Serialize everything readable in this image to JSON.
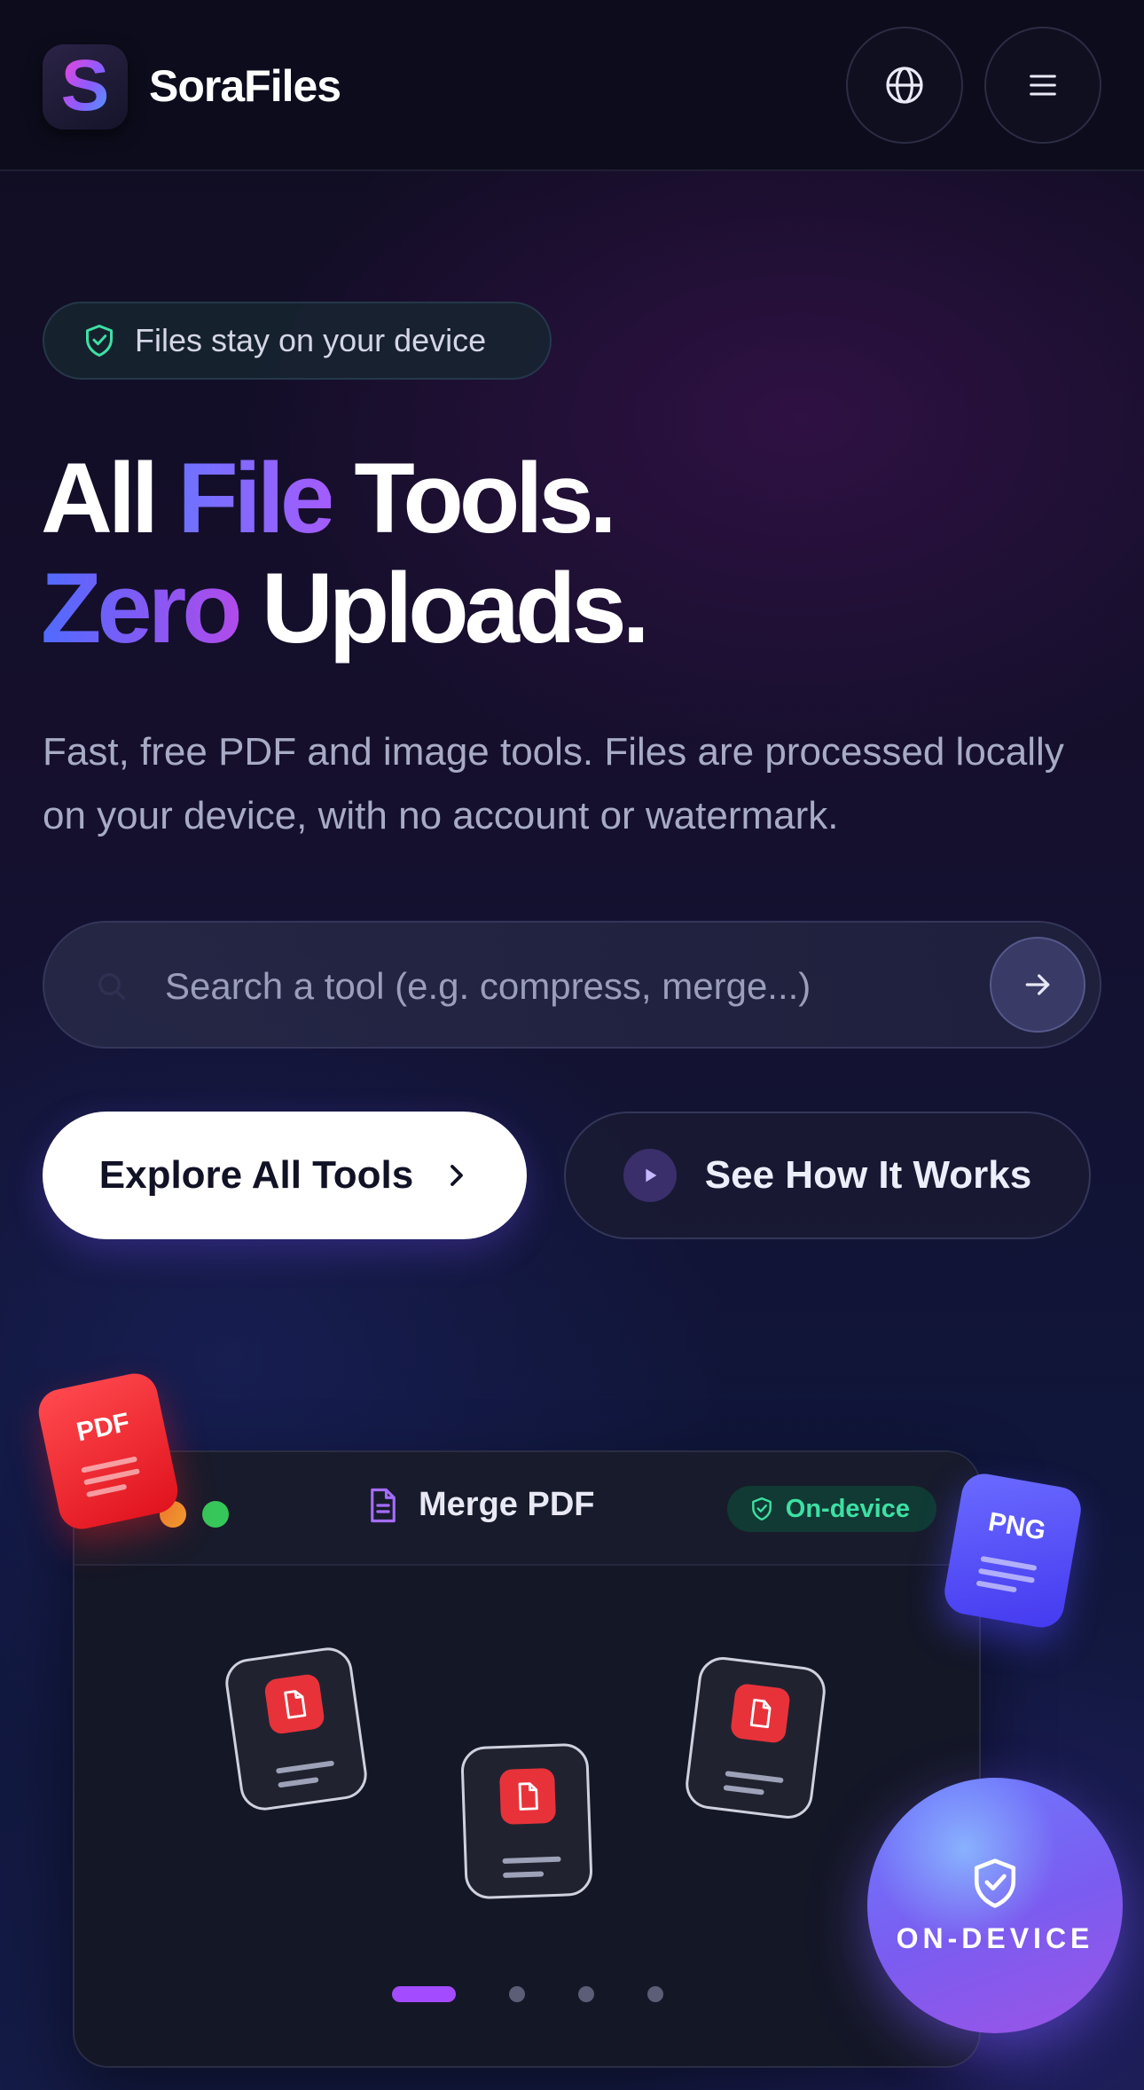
{
  "header": {
    "brand": "SoraFiles",
    "logo_letter": "S",
    "language_icon": "globe-icon",
    "menu_icon": "hamburger-menu-icon"
  },
  "hero": {
    "badge": "Files stay on your device",
    "headline_line1": {
      "w1": "All",
      "w2": "File",
      "w3": "Tools."
    },
    "headline_line2": {
      "w1": "Zero",
      "w2": "Uploads."
    },
    "subtitle": "Fast, free PDF and image tools. Files are processed locally on your device, with no account or watermark."
  },
  "search": {
    "placeholder": "Search a tool (e.g. compress, merge...)",
    "value": ""
  },
  "actions": {
    "primary": "Explore All Tools",
    "secondary": "See How It Works"
  },
  "preview": {
    "title": "Merge PDF",
    "status": "On-device",
    "pages": 4,
    "active_page": 1,
    "floating": {
      "pdf": "PDF",
      "png": "PNG"
    },
    "orb": "ON-DEVICE"
  },
  "colors": {
    "accent_purple": "#a34bff",
    "accent_blue": "#5b6bff",
    "success_green": "#3ee0a4",
    "pdf_red": "#e8323a"
  }
}
